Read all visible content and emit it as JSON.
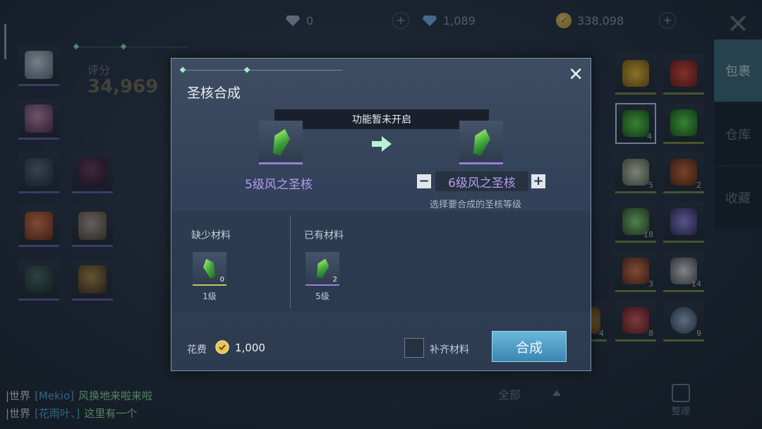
{
  "topbar": {
    "currency1_value": "0",
    "currency2_value": "1,089",
    "currency3_value": "338,098",
    "plus": "+"
  },
  "left": {
    "score_label": "评分",
    "score_value": "34,969"
  },
  "right": {
    "tabs": [
      "包裹",
      "仓库",
      "收藏"
    ],
    "counts": [
      "4",
      "5",
      "2",
      "18",
      "3",
      "14",
      "4",
      "8",
      "9"
    ],
    "filter_label": "全部",
    "sort_label": "整理"
  },
  "chat": [
    {
      "channel": "|世界",
      "name": "[Mekio]",
      "msg": "风换地来啦来啦"
    },
    {
      "channel": "|世界",
      "name": "[花雨叶、]",
      "msg": "这里有一个"
    }
  ],
  "modal": {
    "title": "圣核合成",
    "close": "✕",
    "notice": "功能暂未开启",
    "source_name": "5级风之圣核",
    "target_name": "6级风之圣核",
    "minus": "−",
    "plus": "+",
    "hint": "选择要合成的圣核等级",
    "missing_label": "缺少材料",
    "owned_label": "已有材料",
    "missing_item": {
      "count": "0",
      "level": "1级"
    },
    "owned_item": {
      "count": "2",
      "level": "5级"
    },
    "cost_label": "花费",
    "cost_value": "1,000",
    "auto_fill_label": "补齐材料",
    "synth_button": "合成"
  }
}
